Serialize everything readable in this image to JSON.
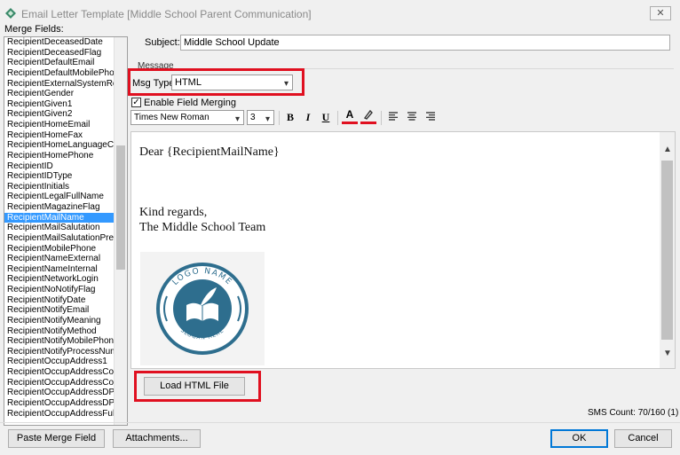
{
  "window": {
    "title": "Email Letter Template [Middle School Parent Communication]",
    "close_label": "✕"
  },
  "merge_fields": {
    "label": "Merge Fields:",
    "items": [
      "RecipientDeceasedDate",
      "RecipientDeceasedFlag",
      "RecipientDefaultEmail",
      "RecipientDefaultMobilePhon",
      "RecipientExternalSystemRe",
      "RecipientGender",
      "RecipientGiven1",
      "RecipientGiven2",
      "RecipientHomeEmail",
      "RecipientHomeFax",
      "RecipientHomeLanguageCo",
      "RecipientHomePhone",
      "RecipientID",
      "RecipientIDType",
      "RecipientInitials",
      "RecipientLegalFullName",
      "RecipientMagazineFlag",
      "RecipientMailName",
      "RecipientMailSalutation",
      "RecipientMailSalutationPrefi",
      "RecipientMobilePhone",
      "RecipientNameExternal",
      "RecipientNameInternal",
      "RecipientNetworkLogin",
      "RecipientNoNotifyFlag",
      "RecipientNotifyDate",
      "RecipientNotifyEmail",
      "RecipientNotifyMeaning",
      "RecipientNotifyMethod",
      "RecipientNotifyMobilePhone",
      "RecipientNotifyProcessNum",
      "RecipientOccupAddress1",
      "RecipientOccupAddressCom",
      "RecipientOccupAddressCom",
      "RecipientOccupAddressDPII",
      "RecipientOccupAddressDPII",
      "RecipientOccupAddressFull"
    ],
    "selected_index": 17
  },
  "subject": {
    "label": "Subject:",
    "value": "Middle School Update"
  },
  "message": {
    "group_label": "Message",
    "msg_type_label": "Msg Type:",
    "msg_type_value": "HTML",
    "enable_merging_label": "Enable Field Merging",
    "enable_merging_checked": true
  },
  "toolbar": {
    "font_name": "Times New Roman",
    "font_size": "3",
    "bold": "B",
    "italic": "I",
    "underline": "U",
    "font_color": "A"
  },
  "editor": {
    "greeting": "Dear {RecipientMailName}",
    "closing_line1": "Kind regards,",
    "closing_line2": "The Middle School Team",
    "logo": {
      "text_top": "LOGO NAME",
      "text_bottom": "SLOGAN HERE",
      "color": "#2e6e8e"
    }
  },
  "load_html_label": "Load HTML File",
  "sms_count": "SMS Count: 70/160 (1)",
  "buttons": {
    "paste_merge": "Paste Merge Field",
    "attachments": "Attachments...",
    "ok": "OK",
    "cancel": "Cancel"
  },
  "colors": {
    "highlight_red": "#e01020",
    "selection_blue": "#3399ff"
  }
}
